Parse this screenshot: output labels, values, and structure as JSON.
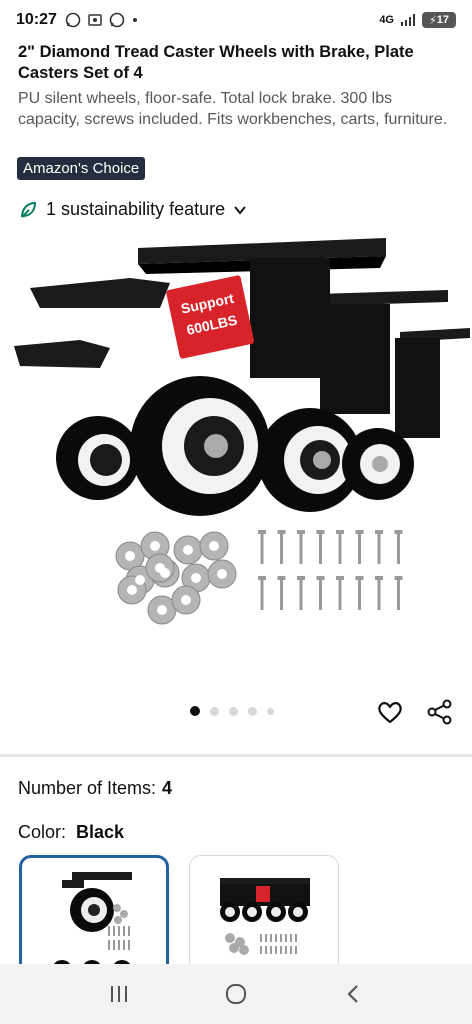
{
  "status_bar": {
    "time": "10:27",
    "network": "4G",
    "battery": "17"
  },
  "product": {
    "title": "2\" Diamond Tread Caster Wheels with Brake, Plate Casters Set of 4",
    "subtitle": "PU silent wheels, floor-safe. Total lock brake. 300 lbs capacity, screws included. Fits workbenches, carts, furniture.",
    "badge_prefix": "Amazon's",
    "badge_suffix": "Choice",
    "sustainability": "1 sustainability feature",
    "image_label_line1": "Support",
    "image_label_line2": "600LBS"
  },
  "carousel": {
    "count": 5,
    "active": 0
  },
  "options": {
    "items_label": "Number of Items:",
    "items_value": "4",
    "color_label": "Color:",
    "color_value": "Black"
  },
  "colors": {
    "accent": "#2162a1",
    "badge_bg": "#232f3e",
    "label_red": "#d9232a"
  },
  "icons": {
    "leaf": "leaf-icon",
    "chevron": "chevron-down-icon",
    "heart": "heart-icon",
    "share": "share-icon",
    "nav_recent": "recent-apps-icon",
    "nav_home": "home-icon",
    "nav_back": "back-icon"
  }
}
